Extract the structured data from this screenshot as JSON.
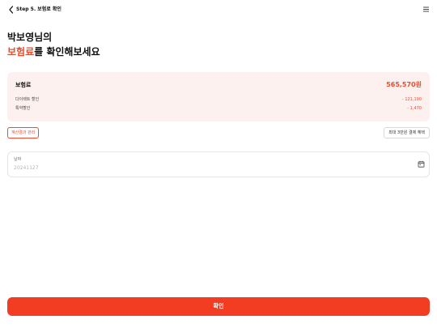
{
  "header": {
    "title": "Step 5. 보험료 확인",
    "back_icon": "chevron-left-icon",
    "menu_icon": "hamburger-menu-icon"
  },
  "heading": {
    "line1": "박보영님의",
    "line2_accent": "보험료",
    "line2_rest": "를 확인해보세요"
  },
  "summary": {
    "premium_label": "보험료",
    "premium_value": "565,570원",
    "discount_rows": [
      {
        "label": "다이렉트 할인",
        "value": "- 121,190"
      },
      {
        "label": "특약할인",
        "value": "- 1,470"
      }
    ]
  },
  "actions": {
    "recalc_label": "계산결과 관리",
    "benefit_label": "최대 3만원 결제 혜택"
  },
  "date_field": {
    "label": "날짜",
    "value": "20241127",
    "icon": "calendar-icon"
  },
  "footer": {
    "confirm_label": "확인"
  },
  "colors": {
    "accent": "#F2492B",
    "button": "#F23D22",
    "card_bg": "#FDF1EF"
  }
}
